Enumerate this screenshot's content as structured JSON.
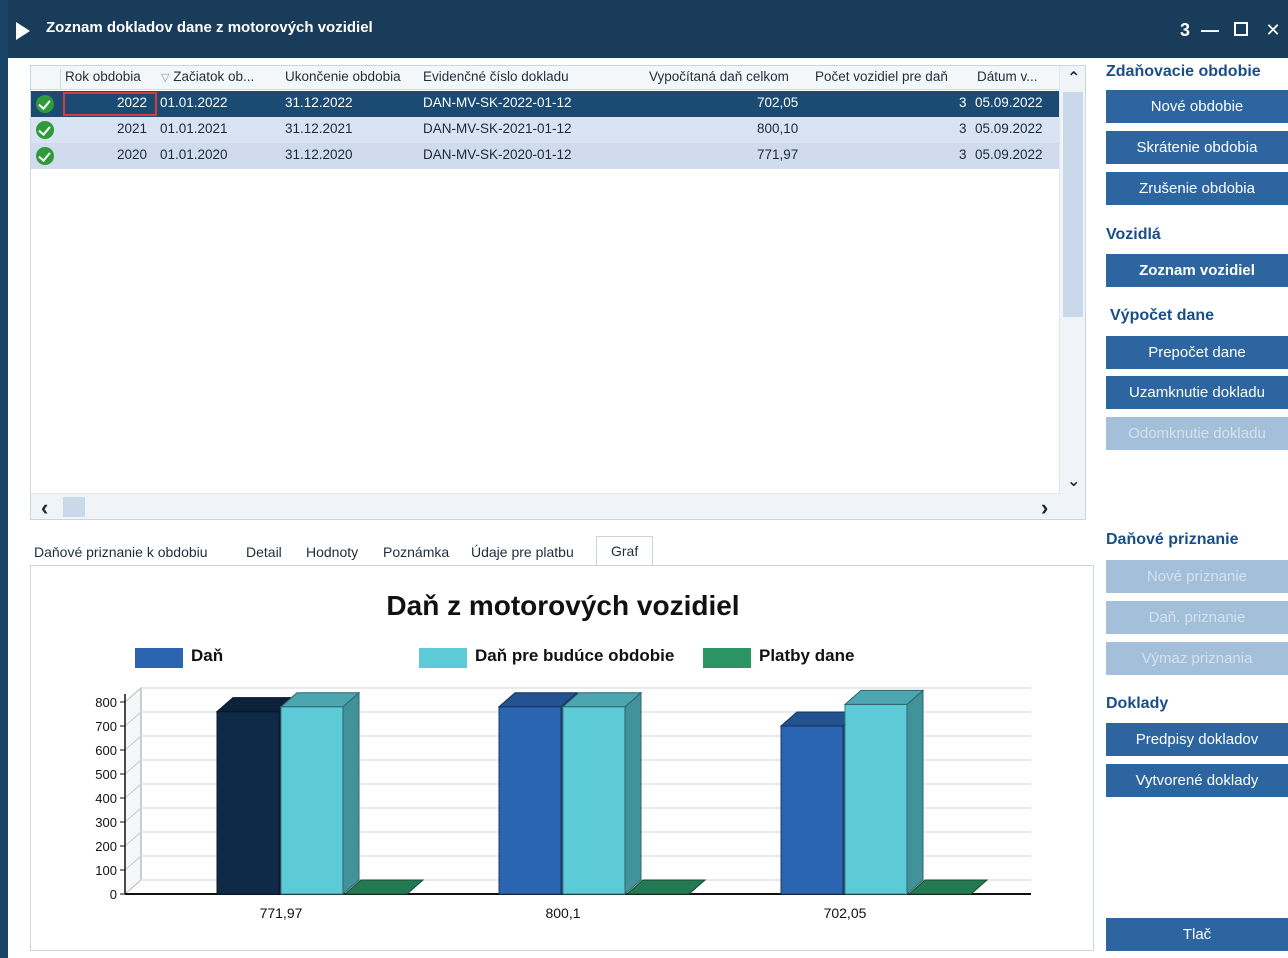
{
  "window": {
    "title": "Zoznam dokladov dane z motorových vozidiel",
    "controls": {
      "count": "3",
      "minimize": "—",
      "close": "✕"
    }
  },
  "grid": {
    "columns": [
      "Rok obdobia",
      "Začiatok ob...",
      "Ukončenie obdobia",
      "Evidenčné číslo dokladu",
      "Vypočítaná daň celkom",
      "Počet vozidiel pre daň",
      "Dátum v..."
    ],
    "sort_glyph": "▽",
    "rows": [
      {
        "rok": "2022",
        "zaciatok": "01.01.2022",
        "ukoncenie": "31.12.2022",
        "cislo": "DAN-MV-SK-2022-01-12",
        "dan": "702,05",
        "pocet": "3",
        "datum": "05.09.2022",
        "status": "ok"
      },
      {
        "rok": "2021",
        "zaciatok": "01.01.2021",
        "ukoncenie": "31.12.2021",
        "cislo": "DAN-MV-SK-2021-01-12",
        "dan": "800,10",
        "pocet": "3",
        "datum": "05.09.2022",
        "status": "ok"
      },
      {
        "rok": "2020",
        "zaciatok": "01.01.2020",
        "ukoncenie": "31.12.2020",
        "cislo": "DAN-MV-SK-2020-01-12",
        "dan": "771,97",
        "pocet": "3",
        "datum": "05.09.2022",
        "status": "ok"
      }
    ],
    "scroll": {
      "up": "⌃",
      "down": "⌄",
      "left": "‹",
      "right": "›"
    }
  },
  "tabs": [
    {
      "label": "Daňové priznanie k obdobiu",
      "active": false
    },
    {
      "label": "Detail",
      "active": false
    },
    {
      "label": "Hodnoty",
      "active": false
    },
    {
      "label": "Poznámka",
      "active": false
    },
    {
      "label": "Údaje pre platbu",
      "active": false
    },
    {
      "label": "Graf",
      "active": true
    }
  ],
  "chart_data": {
    "type": "bar",
    "title": "Daň z motorových vozidiel",
    "categories": [
      "771,97",
      "800,1",
      "702,05"
    ],
    "series": [
      {
        "name": "Daň",
        "values": [
          760,
          780,
          700
        ],
        "color": "#2b64b0"
      },
      {
        "name": "Daň pre budúce obdobie",
        "values": [
          780,
          780,
          790
        ],
        "color": "#5ccbd7"
      },
      {
        "name": "Platby dane",
        "values": [
          0,
          0,
          0
        ],
        "color": "#2b9463"
      }
    ],
    "ylim": [
      0,
      800
    ],
    "yticks": [
      "0",
      "100",
      "200",
      "300",
      "400",
      "500",
      "600",
      "700",
      "800"
    ],
    "legend_position": "top",
    "grid": true,
    "first_bar_color": "#0f2a47"
  },
  "sidebar": {
    "sections": [
      {
        "title": "Zdaňovacie obdobie",
        "buttons": [
          {
            "label": "Nové obdobie",
            "enabled": true
          },
          {
            "label": "Skrátenie obdobia",
            "enabled": true
          },
          {
            "label": "Zrušenie obdobia",
            "enabled": true
          }
        ]
      },
      {
        "title": "Vozidlá",
        "buttons": [
          {
            "label": "Zoznam vozidiel",
            "enabled": true,
            "bold": true
          }
        ]
      },
      {
        "title": "Výpočet dane",
        "buttons": [
          {
            "label": "Prepočet dane",
            "enabled": true
          },
          {
            "label": "Uzamknutie dokladu",
            "enabled": true
          },
          {
            "label": "Odomknutie dokladu",
            "enabled": false
          }
        ]
      },
      {
        "title": "Daňové priznanie",
        "buttons": [
          {
            "label": "Nové priznanie",
            "enabled": false
          },
          {
            "label": "Daň. priznanie",
            "enabled": false
          },
          {
            "label": "Výmaz priznania",
            "enabled": false
          }
        ]
      },
      {
        "title": "Doklady",
        "buttons": [
          {
            "label": "Predpisy dokladov",
            "enabled": true
          },
          {
            "label": "Vytvorené doklady",
            "enabled": true
          }
        ]
      }
    ],
    "print_button": "Tlač"
  }
}
